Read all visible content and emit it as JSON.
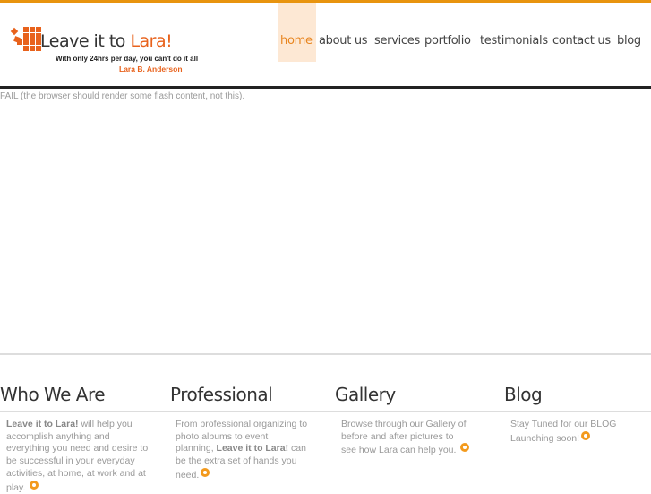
{
  "colors": {
    "accent": "#e8940f",
    "brand_orange": "#e8621c",
    "nav_active_bg": "#fde8d4"
  },
  "logo": {
    "title_part1": "Leave it to",
    "title_part2": "Lara!",
    "tagline": "With only 24hrs per day, you can't do it all",
    "name": "Lara B. Anderson"
  },
  "nav": {
    "items": [
      {
        "label": "home",
        "active": true
      },
      {
        "label": "about us"
      },
      {
        "label": "services"
      },
      {
        "label": "portfolio"
      },
      {
        "label": "testimonials"
      },
      {
        "label": "contact us"
      },
      {
        "label": "blog"
      }
    ]
  },
  "flash_fallback": "FAIL (the browser should render some flash content, not this).",
  "columns": [
    {
      "title": "Who We Are",
      "bold": "Leave it to Lara!",
      "text": " will help you accomplish anything and everything you need and desire to be successful in your everyday activities, at home, at work and at play."
    },
    {
      "title": "Professional",
      "text_before": "From professional organizing to photo albums to event planning, ",
      "bold": "Leave it to Lara!",
      "text": " can be the extra set of hands you need."
    },
    {
      "title": "Gallery",
      "text": "Browse through our Gallery of before and after pictures to see how Lara can help you."
    },
    {
      "title": "Blog",
      "text": "Stay Tuned for our BLOG Launching soon!"
    }
  ]
}
